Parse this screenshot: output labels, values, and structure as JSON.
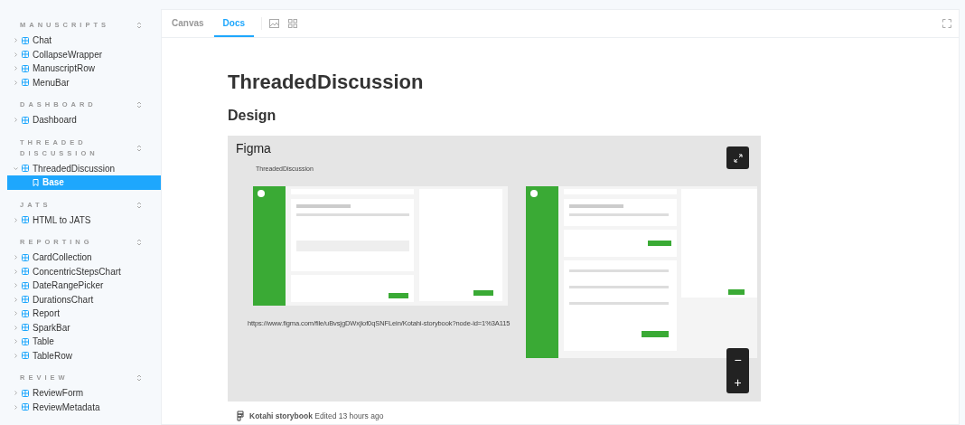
{
  "sidebar": {
    "sections": [
      {
        "title": "MANUSCRIPTS",
        "items": [
          {
            "label": "Chat",
            "expanded": false,
            "selected": false
          },
          {
            "label": "CollapseWrapper",
            "expanded": false,
            "selected": false
          },
          {
            "label": "ManuscriptRow",
            "expanded": false,
            "selected": false
          },
          {
            "label": "MenuBar",
            "expanded": false,
            "selected": false
          }
        ]
      },
      {
        "title": "DASHBOARD",
        "items": [
          {
            "label": "Dashboard",
            "expanded": false,
            "selected": false
          }
        ]
      },
      {
        "title": "THREADED DISCUSSION",
        "items": [
          {
            "label": "ThreadedDiscussion",
            "expanded": true,
            "selected": false,
            "children": [
              {
                "label": "Base",
                "selected": true
              }
            ]
          }
        ]
      },
      {
        "title": "JATS",
        "items": [
          {
            "label": "HTML to JATS",
            "expanded": false,
            "selected": false
          }
        ]
      },
      {
        "title": "REPORTING",
        "items": [
          {
            "label": "CardCollection",
            "expanded": false,
            "selected": false
          },
          {
            "label": "ConcentricStepsChart",
            "expanded": false,
            "selected": false
          },
          {
            "label": "DateRangePicker",
            "expanded": false,
            "selected": false
          },
          {
            "label": "DurationsChart",
            "expanded": false,
            "selected": false
          },
          {
            "label": "Report",
            "expanded": false,
            "selected": false
          },
          {
            "label": "SparkBar",
            "expanded": false,
            "selected": false
          },
          {
            "label": "Table",
            "expanded": false,
            "selected": false
          },
          {
            "label": "TableRow",
            "expanded": false,
            "selected": false
          }
        ]
      },
      {
        "title": "REVIEW",
        "items": [
          {
            "label": "ReviewForm",
            "expanded": false,
            "selected": false
          },
          {
            "label": "ReviewMetadata",
            "expanded": false,
            "selected": false
          }
        ]
      }
    ]
  },
  "tabs": [
    {
      "label": "Canvas",
      "selected": false
    },
    {
      "label": "Docs",
      "selected": true
    }
  ],
  "doc": {
    "title": "ThreadedDiscussion",
    "heading": "Design",
    "embed": {
      "title": "Figma",
      "frame_label": "ThreadedDiscussion",
      "url": "https://www.figma.com/file/uBvsjgDWxjiof0qSNFLein/Kotahi-storybook?node-id=1%3A115",
      "zoom_out": "−",
      "zoom_in": "+"
    },
    "footer": "**Kotahi storybook** Edited 13 hours ago"
  }
}
